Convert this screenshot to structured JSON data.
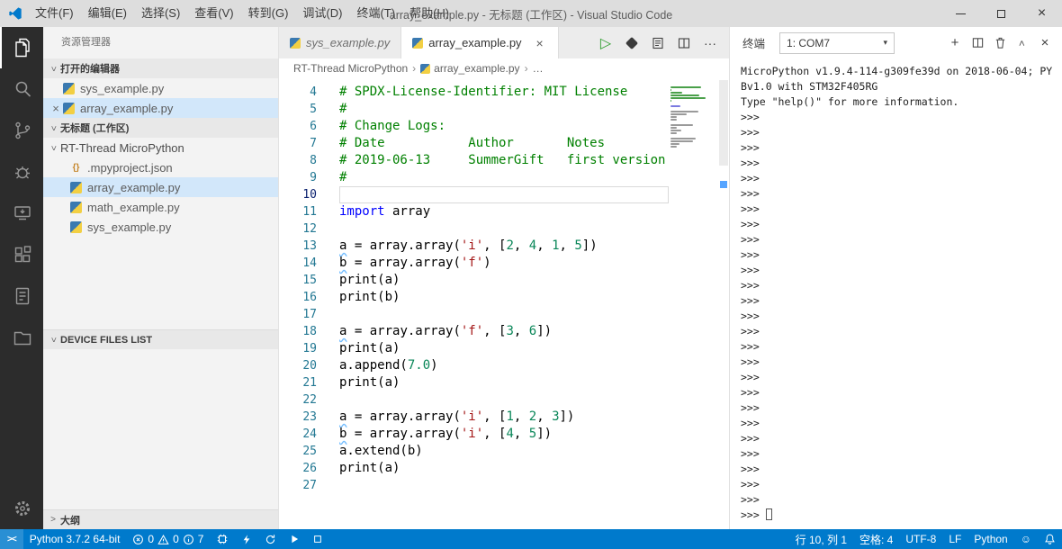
{
  "titlebar": {
    "menus": [
      "文件(F)",
      "编辑(E)",
      "选择(S)",
      "查看(V)",
      "转到(G)",
      "调试(D)",
      "终端(T)",
      "帮助(H)"
    ],
    "title": "array_example.py - 无标题 (工作区) - Visual Studio Code"
  },
  "icons": {
    "close": "×",
    "chev": ">",
    "crumb_sep": "›",
    "more": "···",
    "run": "▷",
    "dropdown": "▾",
    "plus": "+",
    "braces": "{}",
    "smiley": "☺",
    "remote": "><"
  },
  "colors": {
    "accent": "#007acc",
    "selection": "#d2e7fa",
    "comment": "#008000",
    "keyword": "#0000ff",
    "string": "#a31515",
    "number": "#098658"
  },
  "sidebar": {
    "title": "资源管理器",
    "open_editors": {
      "header": "打开的编辑器",
      "items": [
        {
          "label": "sys_example.py",
          "active": false
        },
        {
          "label": "array_example.py",
          "active": true
        }
      ]
    },
    "workspace": {
      "header": "无标题 (工作区)",
      "folder": "RT-Thread MicroPython",
      "files": [
        {
          "label": ".mpyproject.json",
          "icon": "json",
          "selected": false
        },
        {
          "label": "array_example.py",
          "icon": "python",
          "selected": true
        },
        {
          "label": "math_example.py",
          "icon": "python",
          "selected": false
        },
        {
          "label": "sys_example.py",
          "icon": "python",
          "selected": false
        }
      ]
    },
    "device_header": "DEVICE FILES LIST",
    "outline_header": "大纲"
  },
  "editor": {
    "tabs": [
      {
        "label": "sys_example.py",
        "active": false
      },
      {
        "label": "array_example.py",
        "active": true
      }
    ],
    "breadcrumb": [
      "RT-Thread MicroPython",
      "array_example.py",
      "…"
    ],
    "current_line": 10,
    "lines": [
      {
        "n": 4,
        "t": [
          [
            "c",
            "# SPDX-License-Identifier: MIT License"
          ]
        ]
      },
      {
        "n": 5,
        "t": [
          [
            "c",
            "#"
          ]
        ]
      },
      {
        "n": 6,
        "t": [
          [
            "c",
            "# Change Logs:"
          ]
        ]
      },
      {
        "n": 7,
        "t": [
          [
            "c",
            "# Date           Author       Notes"
          ]
        ]
      },
      {
        "n": 8,
        "t": [
          [
            "c",
            "# 2019-06-13     SummerGift   first version"
          ]
        ]
      },
      {
        "n": 9,
        "t": [
          [
            "c",
            "#"
          ]
        ]
      },
      {
        "n": 10,
        "t": []
      },
      {
        "n": 11,
        "t": [
          [
            "k",
            "import"
          ],
          [
            "p",
            " array"
          ]
        ]
      },
      {
        "n": 12,
        "t": []
      },
      {
        "n": 13,
        "t": [
          [
            "pu",
            "a"
          ],
          [
            "p",
            " = array.array("
          ],
          [
            "s",
            "'i'"
          ],
          [
            "p",
            ", ["
          ],
          [
            "n",
            "2"
          ],
          [
            "p",
            ", "
          ],
          [
            "n",
            "4"
          ],
          [
            "p",
            ", "
          ],
          [
            "n",
            "1"
          ],
          [
            "p",
            ", "
          ],
          [
            "n",
            "5"
          ],
          [
            "p",
            "])"
          ]
        ]
      },
      {
        "n": 14,
        "t": [
          [
            "pu",
            "b"
          ],
          [
            "p",
            " = array.array("
          ],
          [
            "s",
            "'f'"
          ],
          [
            "p",
            ")"
          ]
        ]
      },
      {
        "n": 15,
        "t": [
          [
            "p",
            "print(a)"
          ]
        ]
      },
      {
        "n": 16,
        "t": [
          [
            "p",
            "print(b)"
          ]
        ]
      },
      {
        "n": 17,
        "t": []
      },
      {
        "n": 18,
        "t": [
          [
            "pu",
            "a"
          ],
          [
            "p",
            " = array.array("
          ],
          [
            "s",
            "'f'"
          ],
          [
            "p",
            ", ["
          ],
          [
            "n",
            "3"
          ],
          [
            "p",
            ", "
          ],
          [
            "n",
            "6"
          ],
          [
            "p",
            "])"
          ]
        ]
      },
      {
        "n": 19,
        "t": [
          [
            "p",
            "print(a)"
          ]
        ]
      },
      {
        "n": 20,
        "t": [
          [
            "p",
            "a.append("
          ],
          [
            "n",
            "7.0"
          ],
          [
            "p",
            ")"
          ]
        ]
      },
      {
        "n": 21,
        "t": [
          [
            "p",
            "print(a)"
          ]
        ]
      },
      {
        "n": 22,
        "t": []
      },
      {
        "n": 23,
        "t": [
          [
            "pu",
            "a"
          ],
          [
            "p",
            " = array.array("
          ],
          [
            "s",
            "'i'"
          ],
          [
            "p",
            ", ["
          ],
          [
            "n",
            "1"
          ],
          [
            "p",
            ", "
          ],
          [
            "n",
            "2"
          ],
          [
            "p",
            ", "
          ],
          [
            "n",
            "3"
          ],
          [
            "p",
            "])"
          ]
        ]
      },
      {
        "n": 24,
        "t": [
          [
            "pu",
            "b"
          ],
          [
            "p",
            " = array.array("
          ],
          [
            "s",
            "'i'"
          ],
          [
            "p",
            ", ["
          ],
          [
            "n",
            "4"
          ],
          [
            "p",
            ", "
          ],
          [
            "n",
            "5"
          ],
          [
            "p",
            "])"
          ]
        ]
      },
      {
        "n": 25,
        "t": [
          [
            "p",
            "a.extend(b)"
          ]
        ]
      },
      {
        "n": 26,
        "t": [
          [
            "p",
            "print(a)"
          ]
        ]
      },
      {
        "n": 27,
        "t": []
      }
    ]
  },
  "terminal": {
    "tab": "终端",
    "selector": "1: COM7",
    "banner": [
      "MicroPython v1.9.4-114-g309fe39d on 2018-06-04; PY",
      "Bv1.0 with STM32F405RG",
      "Type \"help()\" for more information."
    ],
    "prompt": ">>>",
    "prompt_count": 27
  },
  "statusbar": {
    "python": "Python 3.7.2 64-bit",
    "errors": "0",
    "warnings": "0",
    "infos": "7",
    "line_col": "行 10, 列 1",
    "spaces": "空格: 4",
    "encoding": "UTF-8",
    "eol": "LF",
    "language": "Python"
  }
}
